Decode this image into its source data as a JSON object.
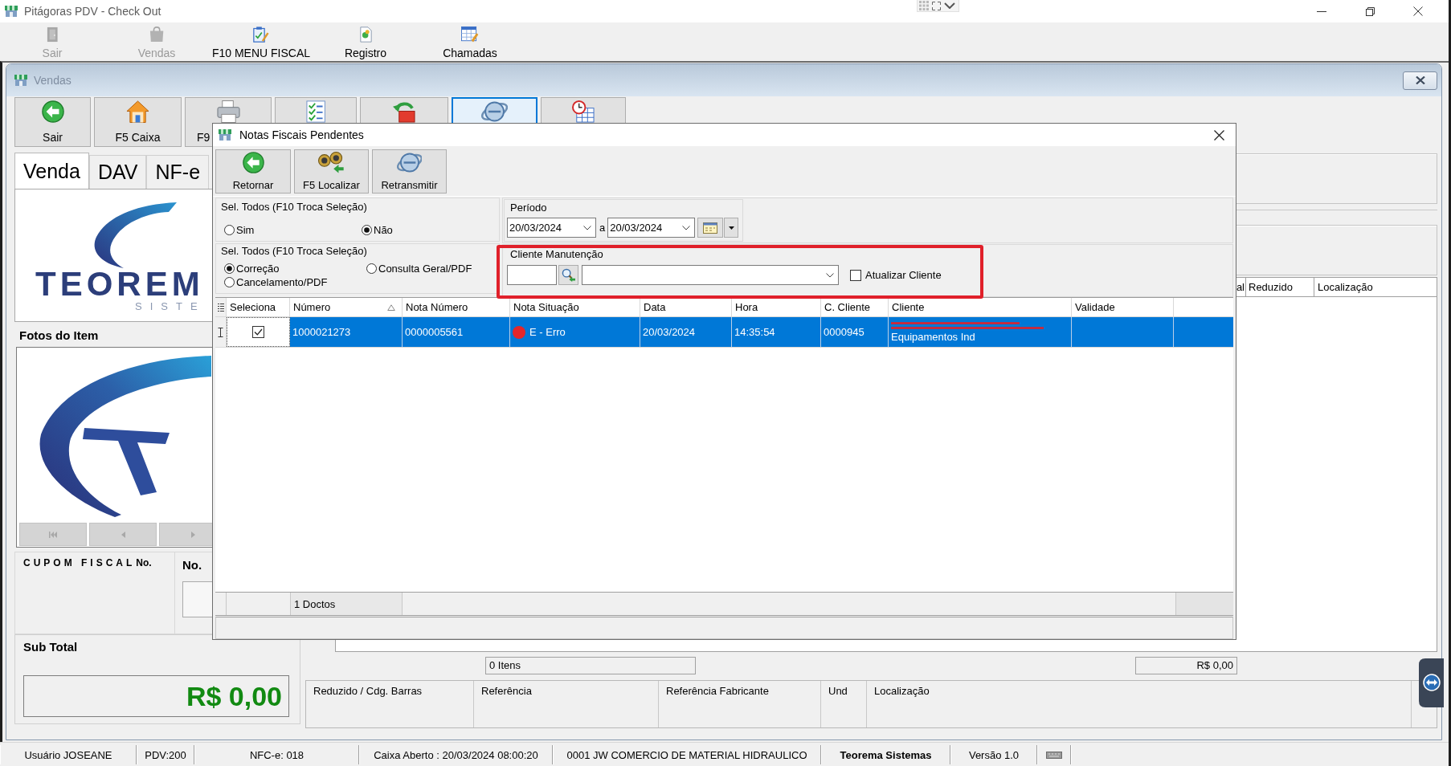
{
  "window": {
    "title": "Pitágoras PDV - Check Out"
  },
  "main_toolbar": [
    {
      "label": "Sair",
      "kind": "exit",
      "disabled": true
    },
    {
      "label": "Vendas",
      "kind": "sales",
      "disabled": true
    },
    {
      "label": "F10 MENU FISCAL",
      "kind": "fiscal",
      "disabled": false
    },
    {
      "label": "Registro",
      "kind": "register",
      "disabled": false
    },
    {
      "label": "Chamadas",
      "kind": "calls",
      "disabled": false
    }
  ],
  "sales_window": {
    "title": "Vendas",
    "toolbar": [
      {
        "label": "Sair",
        "kind": "back",
        "selected": false
      },
      {
        "label": "F5 Caixa",
        "kind": "home",
        "selected": false
      },
      {
        "label": "F9",
        "kind": "printer",
        "selected": false
      },
      {
        "kind": "checklist",
        "selected": false
      },
      {
        "kind": "undo",
        "selected": false
      },
      {
        "kind": "transmit",
        "selected": true
      },
      {
        "kind": "clock",
        "selected": false
      }
    ],
    "tabs": [
      {
        "label": "Venda",
        "selected": true
      },
      {
        "label": "DAV",
        "selected": false
      },
      {
        "label": "NF-e",
        "selected": false
      }
    ],
    "logo": {
      "name": "TEOREM",
      "tagline": "SISTE"
    },
    "photos": {
      "title": "Fotos do Item"
    },
    "receipt": {
      "title": "CUPOM FISCAL",
      "number_label": "No.",
      "next_label": "No."
    },
    "subtotal": {
      "title": "Sub Total",
      "value": "R$ 0,00"
    },
    "items_grid": {
      "columns": [
        "al",
        "Reduzido",
        "Localização"
      ]
    },
    "totals": {
      "count": "0 Itens",
      "amount": "R$ 0,00"
    },
    "details": [
      "Reduzido / Cdg. Barras",
      "Referência",
      "Referência Fabricante",
      "Und",
      "Localização"
    ]
  },
  "dialog": {
    "title": "Notas Fiscais Pendentes",
    "toolbar": [
      {
        "label": "Retornar",
        "kind": "back"
      },
      {
        "label": "F5 Localizar",
        "kind": "find"
      },
      {
        "label": "Retransmitir",
        "kind": "transmit"
      }
    ],
    "select_all": {
      "title": "Sel. Todos (F10 Troca Seleção)",
      "options": [
        {
          "label": "Sim",
          "selected": false
        },
        {
          "label": "Não",
          "selected": true
        }
      ]
    },
    "note_type": {
      "title": "Sel. Todos (F10 Troca Seleção)",
      "options": [
        {
          "label": "Correção",
          "selected": true
        },
        {
          "label": "Consulta Geral/PDF",
          "selected": false
        },
        {
          "label": "Cancelamento/PDF",
          "selected": false
        }
      ]
    },
    "period": {
      "title": "Período",
      "from": "20/03/2024",
      "separator": "a",
      "to": "20/03/2024"
    },
    "client": {
      "title": "Cliente Manutenção",
      "highlighted": true,
      "update_client": {
        "label": "Atualizar Cliente",
        "checked": false
      }
    },
    "grid": {
      "columns": [
        {
          "label": "Seleciona",
          "sorted": false
        },
        {
          "label": "Número",
          "sorted": true
        },
        {
          "label": "Nota Número",
          "sorted": false
        },
        {
          "label": "Nota Situação",
          "sorted": false
        },
        {
          "label": "Data",
          "sorted": false
        },
        {
          "label": "Hora",
          "sorted": false
        },
        {
          "label": "C. Cliente",
          "sorted": false
        },
        {
          "label": "Cliente",
          "sorted": false
        },
        {
          "label": "Validade",
          "sorted": false
        }
      ],
      "rows": [
        {
          "selected": true,
          "current": true,
          "checked": true,
          "numero": "1000021273",
          "nota_numero": "0000005561",
          "situacao": {
            "text": "E - Erro",
            "color": "#e3262b"
          },
          "data": "20/03/2024",
          "hora": "14:35:54",
          "c_cliente": "0000945",
          "cliente": {
            "text": "Equipamentos Ind",
            "redacted": true
          }
        }
      ]
    },
    "footer": {
      "count": "1 Doctos"
    }
  },
  "status_bar": [
    {
      "text": "Usuário JOSEANE",
      "bold": false
    },
    {
      "text": "PDV:200",
      "bold": false
    },
    {
      "text": "NFC-e: 018",
      "bold": false
    },
    {
      "text": "Caixa Aberto : 20/03/2024 08:00:20",
      "bold": false
    },
    {
      "text": "0001 JW COMERCIO DE MATERIAL HIDRAULICO",
      "bold": false
    },
    {
      "text": "Teorema Sistemas",
      "bold": true
    },
    {
      "text": "Versão 1.0",
      "bold": false
    }
  ]
}
